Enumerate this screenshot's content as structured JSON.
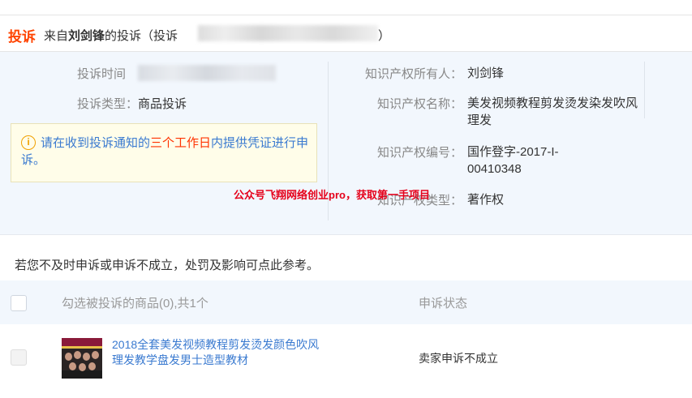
{
  "header": {
    "tag": "投诉",
    "from_prefix": "来自",
    "from_name": "刘剑锋",
    "from_suffix": "的投诉（投诉",
    "tail": "）"
  },
  "info": {
    "complaint_time_label": "投诉时间",
    "complaint_type_label": "投诉类型：",
    "complaint_type_value": "商品投诉",
    "notice": {
      "icon": "info-icon",
      "text_before": "请在收到投诉通知的",
      "text_highlight": "三个工作日",
      "text_after": "内提供凭证进行申诉。"
    },
    "ip_owner_label": "知识产权所有人：",
    "ip_owner_value": "刘剑锋",
    "ip_name_label": "知识产权名称：",
    "ip_name_value": "美发视频教程剪发烫发染发吹风理发",
    "ip_number_label": "知识产权编号：",
    "ip_number_value": "国作登字-2017-I-00410348",
    "ip_type_label": "知识产权类型：",
    "ip_type_value": "著作权",
    "watermark": "公众号飞翔网络创业pro，获取第一手项目"
  },
  "hint": "若您不及时申诉或申诉不成立，处罚及影响可点此参考。",
  "table": {
    "col_select": "勾选被投诉的商品(0),共1个",
    "col_status": "申诉状态",
    "rows": [
      {
        "product": "2018全套美发视频教程剪发烫发颜色吹风理发教学盘发男士造型教材",
        "status": "卖家申诉不成立"
      }
    ]
  },
  "colors": {
    "accent": "#ff4400",
    "link": "#3a7ad0",
    "panel_bg": "#f2f7fd",
    "notice_bg": "#fffde9"
  }
}
